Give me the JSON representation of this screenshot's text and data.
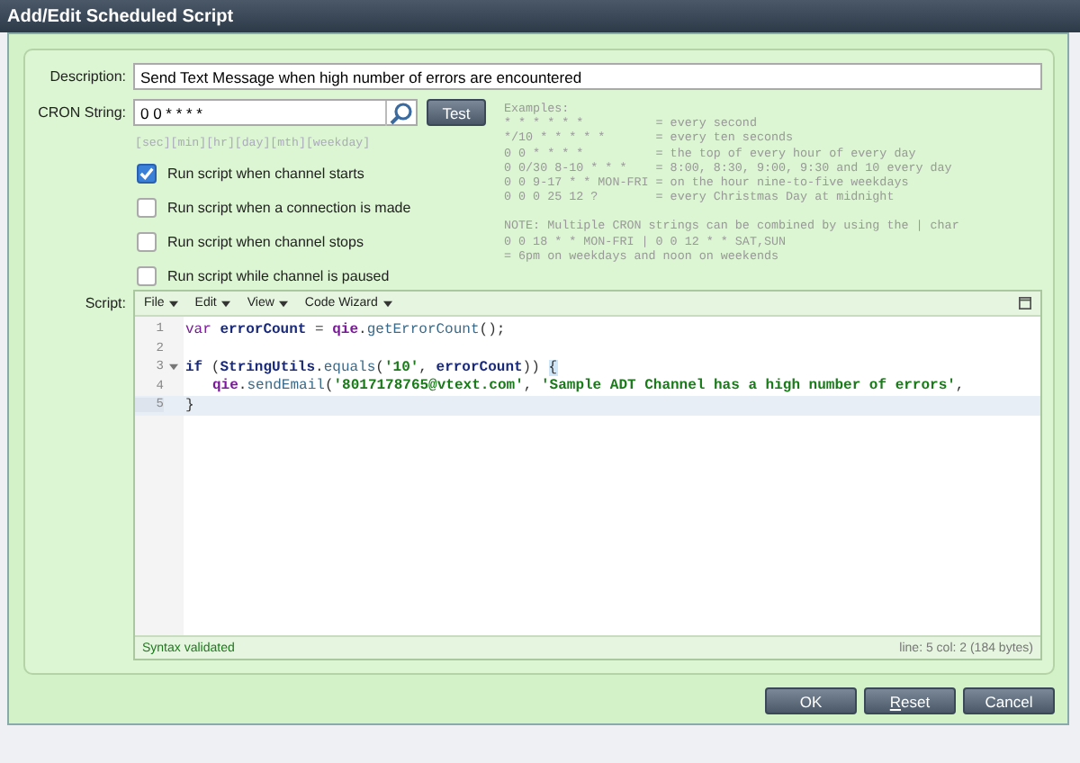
{
  "window": {
    "title": "Add/Edit Scheduled Script"
  },
  "description": {
    "label": "Description:",
    "value": "Send Text Message when high number of errors are encountered"
  },
  "cron": {
    "label": "CRON String:",
    "value": "0 0 * * * *",
    "test_button": "Test",
    "hint": "[sec][min][hr][day][mth][weekday]"
  },
  "examples": [
    [
      "Examples:",
      "* * * * * *          = every second",
      "*/10 * * * * *       = every ten seconds",
      "0 0 * * * *          = the top of every hour of every day",
      "0 0/30 8-10 * * *    = 8:00, 8:30, 9:00, 9:30 and 10 every day",
      "0 0 9-17 * * MON-FRI = on the hour nine-to-five weekdays",
      "0 0 0 25 12 ?        = every Christmas Day at midnight"
    ],
    [
      "NOTE: Multiple CRON strings can be combined by using the | char",
      "0 0 18 * * MON-FRI | 0 0 12 * * SAT,SUN",
      "= 6pm on weekdays and noon on weekends"
    ]
  ],
  "options": [
    {
      "label": "Run script when channel starts",
      "checked": true
    },
    {
      "label": "Run script when a connection is made",
      "checked": false
    },
    {
      "label": "Run script when channel stops",
      "checked": false
    },
    {
      "label": "Run script while channel is paused",
      "checked": false
    }
  ],
  "script": {
    "label": "Script:",
    "menus": [
      "File",
      "Edit",
      "View",
      "Code Wizard"
    ],
    "lines": [
      {
        "number": "1",
        "foldable": false,
        "selected": false,
        "tokens": [
          {
            "kind": "keyword",
            "text": "var "
          },
          {
            "kind": "variable",
            "text": "errorCount"
          },
          {
            "kind": "plain",
            "text": " = "
          },
          {
            "kind": "object",
            "text": "qie"
          },
          {
            "kind": "plain",
            "text": "."
          },
          {
            "kind": "method",
            "text": "getErrorCount"
          },
          {
            "kind": "plain",
            "text": "();"
          }
        ]
      },
      {
        "number": "2",
        "foldable": false,
        "selected": false
      },
      {
        "number": "3",
        "foldable": true,
        "selected": false,
        "tokens": [
          {
            "kind": "keyword-bold",
            "text": "if"
          },
          {
            "kind": "plain",
            "text": " ("
          },
          {
            "kind": "variable",
            "text": "StringUtils"
          },
          {
            "kind": "plain",
            "text": "."
          },
          {
            "kind": "method",
            "text": "equals"
          },
          {
            "kind": "plain",
            "text": "("
          },
          {
            "kind": "string",
            "text": "'10'"
          },
          {
            "kind": "plain",
            "text": ", "
          },
          {
            "kind": "variable",
            "text": "errorCount"
          },
          {
            "kind": "plain",
            "text": ")) "
          },
          {
            "kind": "bracket",
            "text": "{"
          }
        ]
      },
      {
        "number": "4",
        "foldable": false,
        "selected": false,
        "indented": true,
        "tokens": [
          {
            "kind": "object",
            "text": "qie"
          },
          {
            "kind": "plain",
            "text": "."
          },
          {
            "kind": "method",
            "text": "sendEmail"
          },
          {
            "kind": "plain",
            "text": "("
          },
          {
            "kind": "string",
            "text": "'8017178765@vtext.com'"
          },
          {
            "kind": "plain",
            "text": ", "
          },
          {
            "kind": "string",
            "text": "'Sample ADT Channel has a high number of errors'"
          },
          {
            "kind": "plain",
            "text": ","
          }
        ]
      },
      {
        "number": "5",
        "foldable": false,
        "selected": true,
        "tokens": [
          {
            "kind": "plain",
            "text": "}"
          }
        ]
      }
    ],
    "status": "Syntax validated",
    "position": "line: 5  col: 2  (184 bytes)"
  },
  "buttons": [
    {
      "label": "OK",
      "mnemonic_underlined": false
    },
    {
      "label": "Reset",
      "mnemonic_underlined": true
    },
    {
      "label": "Cancel",
      "mnemonic_underlined": false
    }
  ]
}
